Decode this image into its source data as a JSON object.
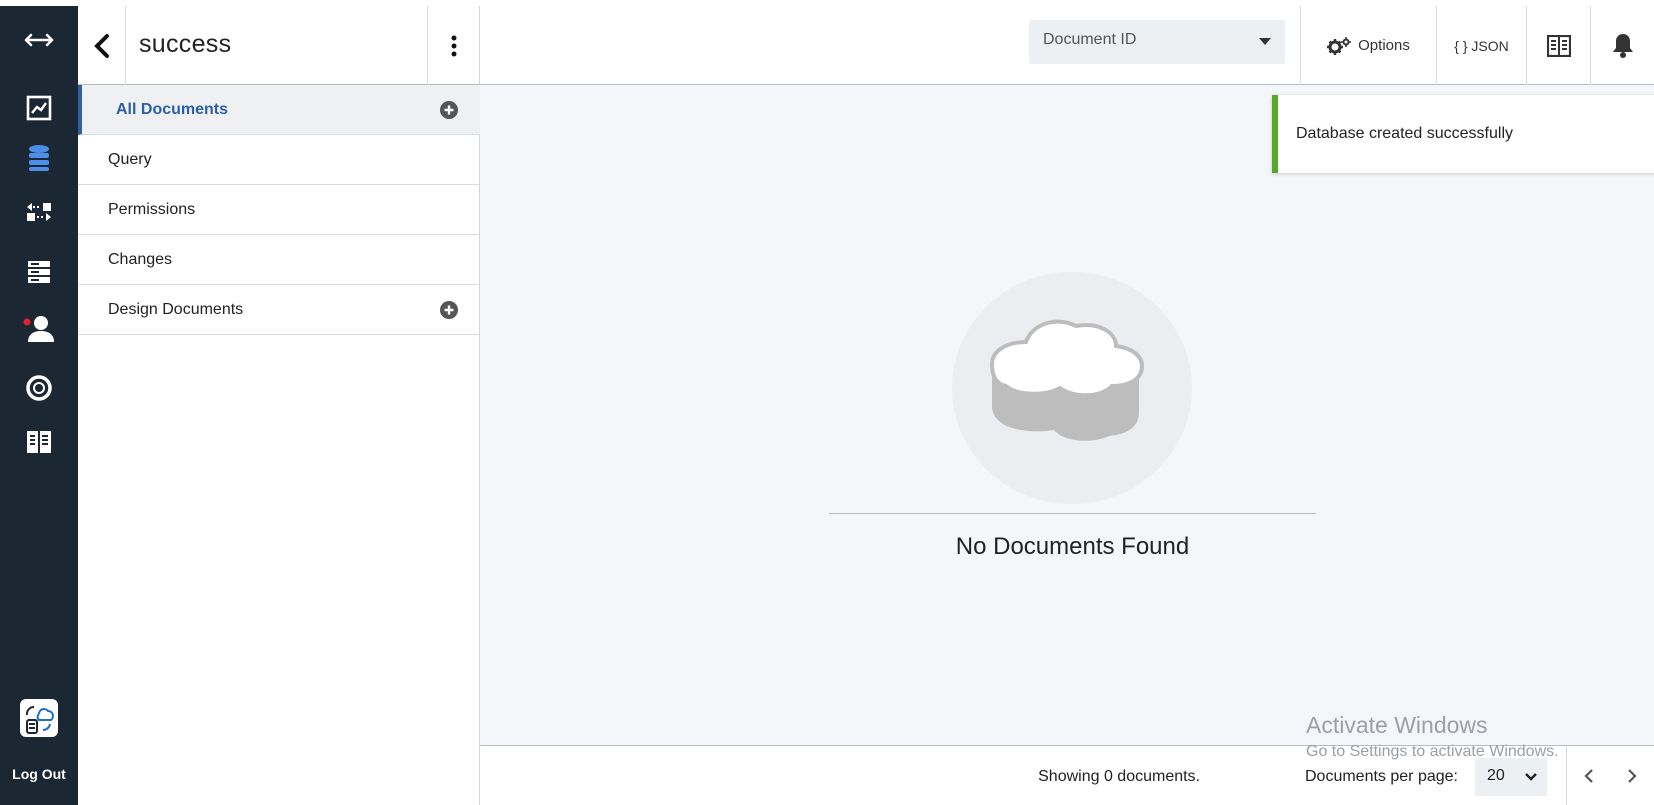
{
  "rail": {
    "items": [
      {
        "name": "toggle-nav-icon"
      },
      {
        "name": "activity-chart-icon"
      },
      {
        "name": "databases-icon"
      },
      {
        "name": "replication-icon"
      },
      {
        "name": "server-icon"
      },
      {
        "name": "user-management-icon"
      },
      {
        "name": "support-lifebuoy-icon"
      },
      {
        "name": "documentation-book-icon"
      },
      {
        "name": "cloud-account-icon"
      }
    ],
    "logout_label": "Log Out",
    "accent_color": "#4c8ee8"
  },
  "database": {
    "name": "success",
    "nav": [
      {
        "label": "All Documents",
        "active": true,
        "addable": true
      },
      {
        "label": "Query",
        "active": false,
        "addable": false
      },
      {
        "label": "Permissions",
        "active": false,
        "addable": false
      },
      {
        "label": "Changes",
        "active": false,
        "addable": false
      },
      {
        "label": "Design Documents",
        "active": false,
        "addable": true
      }
    ]
  },
  "toolbar": {
    "select_value": "Document ID",
    "options_label": "Options",
    "json_label": "{ } JSON"
  },
  "notification": {
    "message": "Database created successfully",
    "status_color": "#58a62a"
  },
  "empty_state": {
    "message": "No Documents Found"
  },
  "footer": {
    "showing_text": "Showing 0 documents.",
    "per_page_label": "Documents per page:",
    "per_page_value": "20"
  },
  "watermark": {
    "line1": "Activate Windows",
    "line2": "Go to Settings to activate Windows."
  }
}
